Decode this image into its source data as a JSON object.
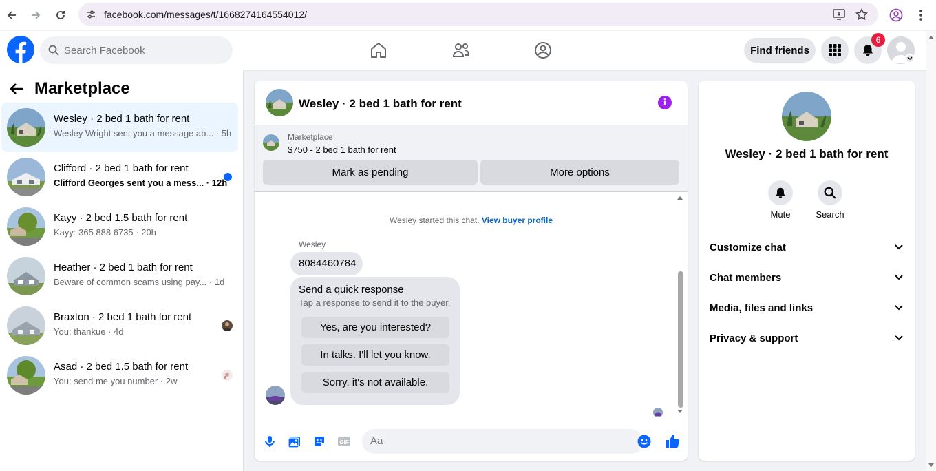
{
  "browser": {
    "url": "facebook.com/messages/t/1668274164554012/"
  },
  "topbar": {
    "search_placeholder": "Search Facebook",
    "find_friends_label": "Find friends",
    "notification_count": "6"
  },
  "sidebar": {
    "title": "Marketplace",
    "conversations": [
      {
        "name": "Wesley · 2 bed 1 bath for rent",
        "preview": "Wesley Wright sent you a message ab...",
        "time": "5h",
        "active": true,
        "unread": false
      },
      {
        "name": "Clifford · 2 bed 1 bath for rent",
        "preview": "Clifford Georges sent you a mess...",
        "time": "12h",
        "active": false,
        "unread": true
      },
      {
        "name": "Kayy · 2 bed 1.5 bath for rent",
        "preview": "Kayy: 365 888 6735",
        "time": "20h",
        "active": false,
        "unread": false
      },
      {
        "name": "Heather · 2 bed 1 bath for rent",
        "preview": "Beware of common scams using pay...",
        "time": "1d",
        "active": false,
        "unread": false
      },
      {
        "name": "Braxton · 2 bed 1 bath for rent",
        "preview": "You: thankue",
        "time": "4d",
        "active": false,
        "unread": false
      },
      {
        "name": "Asad · 2 bed 1.5 bath for rent",
        "preview": "You: send me you number",
        "time": "2w",
        "active": false,
        "unread": false
      }
    ]
  },
  "chat": {
    "title": "Wesley · 2 bed 1 bath for rent",
    "listing": {
      "category": "Marketplace",
      "title": "$750 - 2 bed 1 bath for rent",
      "mark_pending_label": "Mark as pending",
      "more_options_label": "More options"
    },
    "started_text": "Wesley started this chat.",
    "view_buyer_profile": "View buyer profile",
    "sender_name": "Wesley",
    "message_text": "8084460784",
    "quick_response": {
      "title": "Send a quick response",
      "subtitle": "Tap a response to send it to the buyer.",
      "options": [
        "Yes, are you interested?",
        "In talks. I'll let you know.",
        "Sorry, it's not available."
      ]
    },
    "composer_placeholder": "Aa"
  },
  "info_panel": {
    "title": "Wesley · 2 bed 1 bath for rent",
    "mute_label": "Mute",
    "search_label": "Search",
    "sections": [
      "Customize chat",
      "Chat members",
      "Media, files and links",
      "Privacy & support"
    ]
  },
  "colors": {
    "accent": "#0866ff",
    "active_bg": "#ebf5ff",
    "info_icon": "#a020f0",
    "badge": "#e41e3f"
  }
}
